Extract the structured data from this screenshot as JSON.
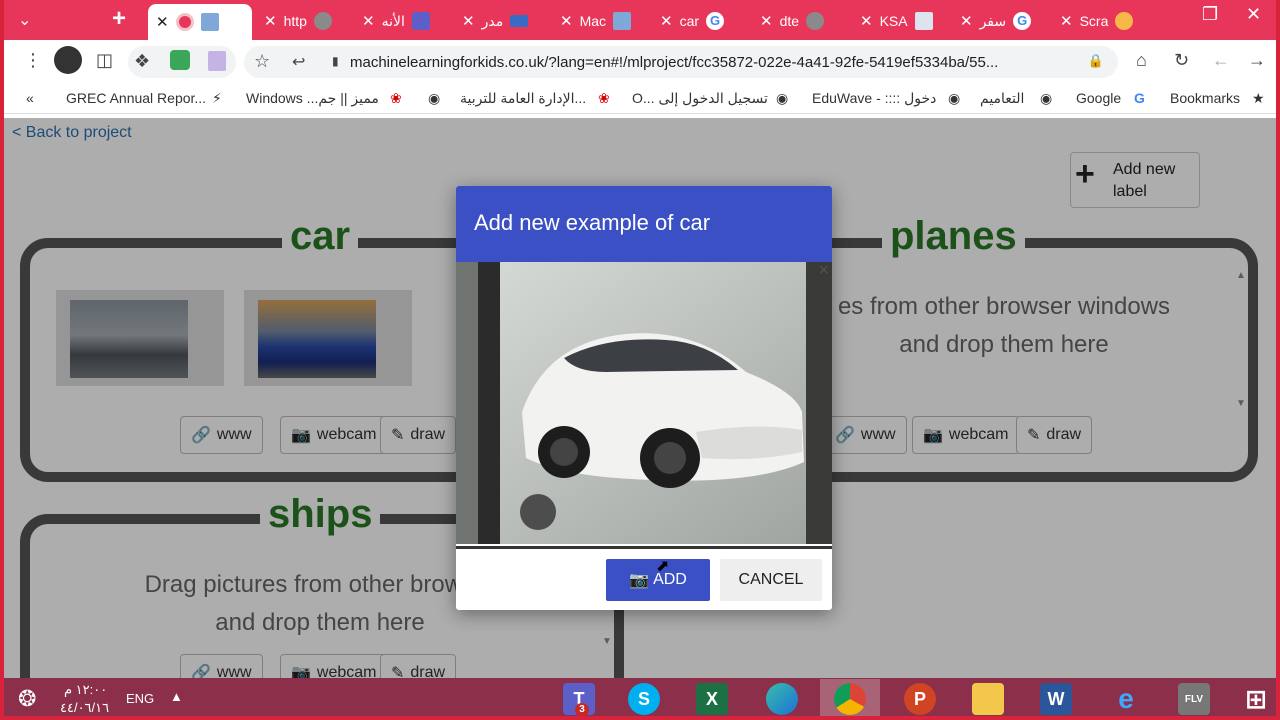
{
  "tabs": [
    {
      "label": "",
      "close": "✕",
      "active": true
    },
    {
      "label": "http",
      "close": "✕"
    },
    {
      "label": "الأنه",
      "close": "✕"
    },
    {
      "label": "مدر",
      "close": "✕"
    },
    {
      "label": "Mac",
      "close": "✕"
    },
    {
      "label": "car",
      "close": "✕"
    },
    {
      "label": "dte",
      "close": "✕"
    },
    {
      "label": "KSA",
      "close": "✕"
    },
    {
      "label": "سفر",
      "close": "✕"
    },
    {
      "label": "Scra",
      "close": "✕"
    }
  ],
  "toolbar": {
    "url": "machinelearningforkids.co.uk/?lang=en#!/mlproject/fcc35872-022e-4a41-92fe-5419ef5334ba/55..."
  },
  "bookmarks": [
    "GREC Annual Repor...",
    "Windows ...مميز || جم",
    "الإدارة العامة للتربية...",
    "O... تسجيل الدخول إلى",
    "EduWave - :::: دخول",
    "التعاميم",
    "Google",
    "Bookmarks"
  ],
  "page": {
    "back_link": "< Back to project",
    "add_label": [
      "Add new",
      "label"
    ],
    "buckets": {
      "car": {
        "title": "car"
      },
      "planes": {
        "title": "planes",
        "drop_text": [
          "es from other browser windows",
          "and drop them here"
        ]
      },
      "ships": {
        "title": "ships",
        "drop_text": [
          "Drag pictures from other browser",
          "and drop them here"
        ]
      }
    },
    "tools": {
      "www": "www",
      "webcam": "webcam",
      "draw": "draw"
    }
  },
  "dialog": {
    "title": "Add new example of car",
    "add": "ADD",
    "cancel": "CANCEL"
  },
  "taskbar": {
    "time": "١٢:٠٠ م",
    "date": "٤٤/٠٦/١٦",
    "lang": "ENG",
    "teams_badge": "3",
    "flv_label": "FLV"
  },
  "colors": {
    "tab_strip": "#e8365a",
    "dialog_header": "#3a50c4",
    "bucket_title": "#2a7a26",
    "taskbar": "#8c2f4a"
  }
}
